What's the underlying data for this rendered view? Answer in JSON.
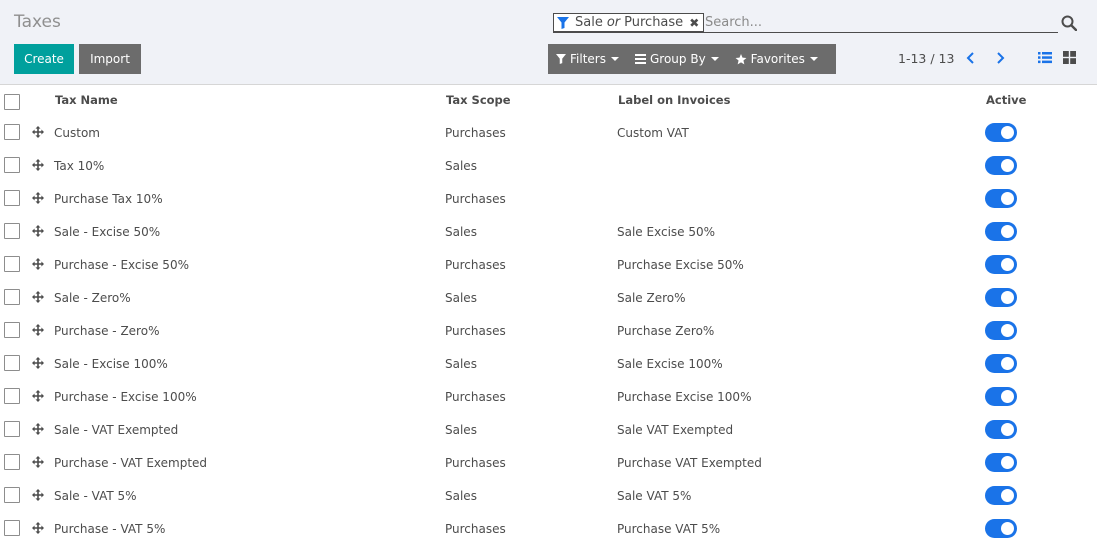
{
  "header": {
    "title": "Taxes"
  },
  "search": {
    "facet_part1": "Sale",
    "facet_or": "or",
    "facet_part2": "Purchase",
    "facet_remove": "✖",
    "placeholder": "Search..."
  },
  "buttons": {
    "create": "Create",
    "import": "Import"
  },
  "search_options": {
    "filters": "Filters",
    "group_by": "Group By",
    "favorites": "Favorites"
  },
  "pager": {
    "value": "1-13 / 13"
  },
  "colors": {
    "accent": "#00a09d",
    "toggle_on": "#1a73e8",
    "facet_icon": "#1a73e8",
    "nav_arrows": "#1a73e8"
  },
  "table": {
    "columns": {
      "name": "Tax Name",
      "scope": "Tax Scope",
      "label": "Label on Invoices",
      "active": "Active"
    },
    "rows": [
      {
        "name": "Custom",
        "scope": "Purchases",
        "label": "Custom VAT",
        "active": true
      },
      {
        "name": "Tax 10%",
        "scope": "Sales",
        "label": "",
        "active": true
      },
      {
        "name": "Purchase Tax 10%",
        "scope": "Purchases",
        "label": "",
        "active": true
      },
      {
        "name": "Sale - Excise 50%",
        "scope": "Sales",
        "label": "Sale Excise 50%",
        "active": true
      },
      {
        "name": "Purchase - Excise 50%",
        "scope": "Purchases",
        "label": "Purchase Excise 50%",
        "active": true
      },
      {
        "name": "Sale - Zero%",
        "scope": "Sales",
        "label": "Sale Zero%",
        "active": true
      },
      {
        "name": "Purchase - Zero%",
        "scope": "Purchases",
        "label": "Purchase Zero%",
        "active": true
      },
      {
        "name": "Sale - Excise 100%",
        "scope": "Sales",
        "label": "Sale Excise 100%",
        "active": true
      },
      {
        "name": "Purchase - Excise 100%",
        "scope": "Purchases",
        "label": "Purchase Excise 100%",
        "active": true
      },
      {
        "name": "Sale - VAT Exempted",
        "scope": "Sales",
        "label": "Sale VAT Exempted",
        "active": true
      },
      {
        "name": "Purchase - VAT Exempted",
        "scope": "Purchases",
        "label": "Purchase VAT Exempted",
        "active": true
      },
      {
        "name": "Sale - VAT 5%",
        "scope": "Sales",
        "label": "Sale VAT 5%",
        "active": true
      },
      {
        "name": "Purchase - VAT 5%",
        "scope": "Purchases",
        "label": "Purchase VAT 5%",
        "active": true
      }
    ]
  }
}
